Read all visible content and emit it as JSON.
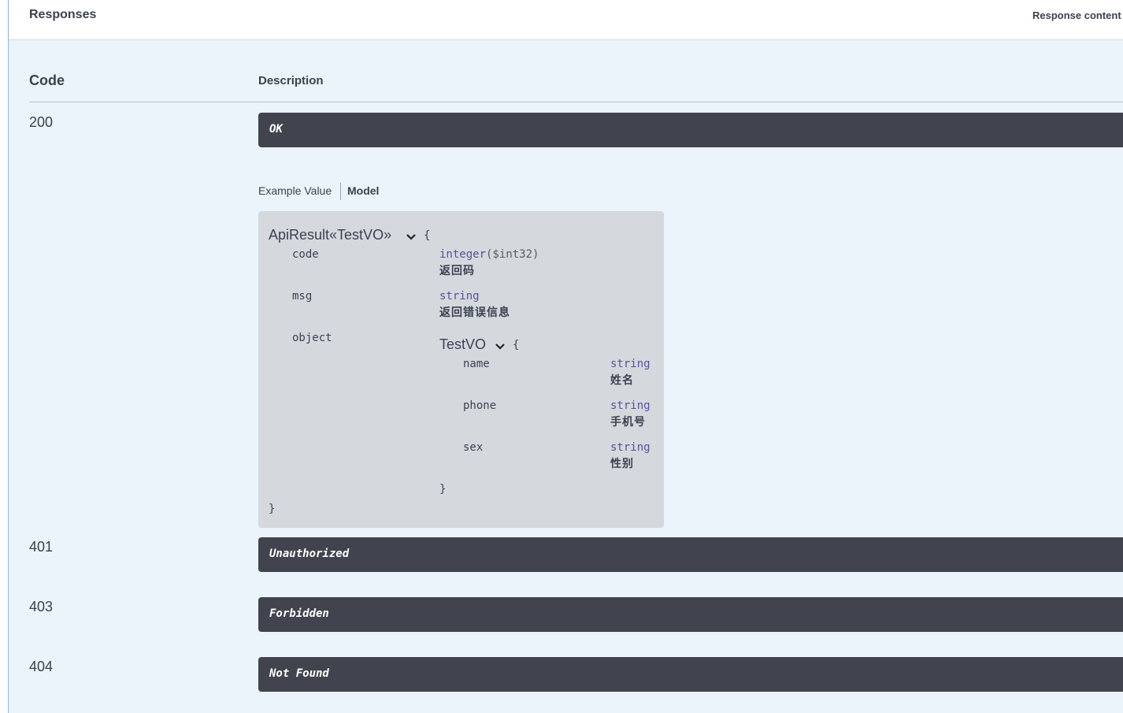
{
  "responses_title": "Responses",
  "response_content_label": "Response content",
  "table": {
    "code_header": "Code",
    "description_header": "Description"
  },
  "responses": [
    {
      "code": "200",
      "description": "OK"
    },
    {
      "code": "401",
      "description": "Unauthorized"
    },
    {
      "code": "403",
      "description": "Forbidden"
    },
    {
      "code": "404",
      "description": "Not Found"
    }
  ],
  "tabs": {
    "example": "Example Value",
    "model": "Model",
    "active": "Model"
  },
  "model": {
    "name": "ApiResult«TestVO»",
    "open_brace": "{",
    "close_brace": "}",
    "fields": [
      {
        "name": "code",
        "type": "integer",
        "format": "($int32)",
        "description": "返回码"
      },
      {
        "name": "msg",
        "type": "string",
        "description": "返回错误信息"
      },
      {
        "name": "object",
        "ref": "TestVO"
      }
    ],
    "nested": {
      "name": "TestVO",
      "open_brace": "{",
      "close_brace": "}",
      "fields": [
        {
          "name": "name",
          "type": "string",
          "description": "姓名"
        },
        {
          "name": "phone",
          "type": "string",
          "description": "手机号"
        },
        {
          "name": "sex",
          "type": "string",
          "description": "性别"
        }
      ]
    }
  },
  "icons": {
    "expand": "chevron-down-icon"
  },
  "colors": {
    "bar": "#41444e",
    "panel": "#ebf3fb",
    "model_bg": "#d5d9de",
    "type": "#55519a",
    "text": "#3b4151"
  }
}
